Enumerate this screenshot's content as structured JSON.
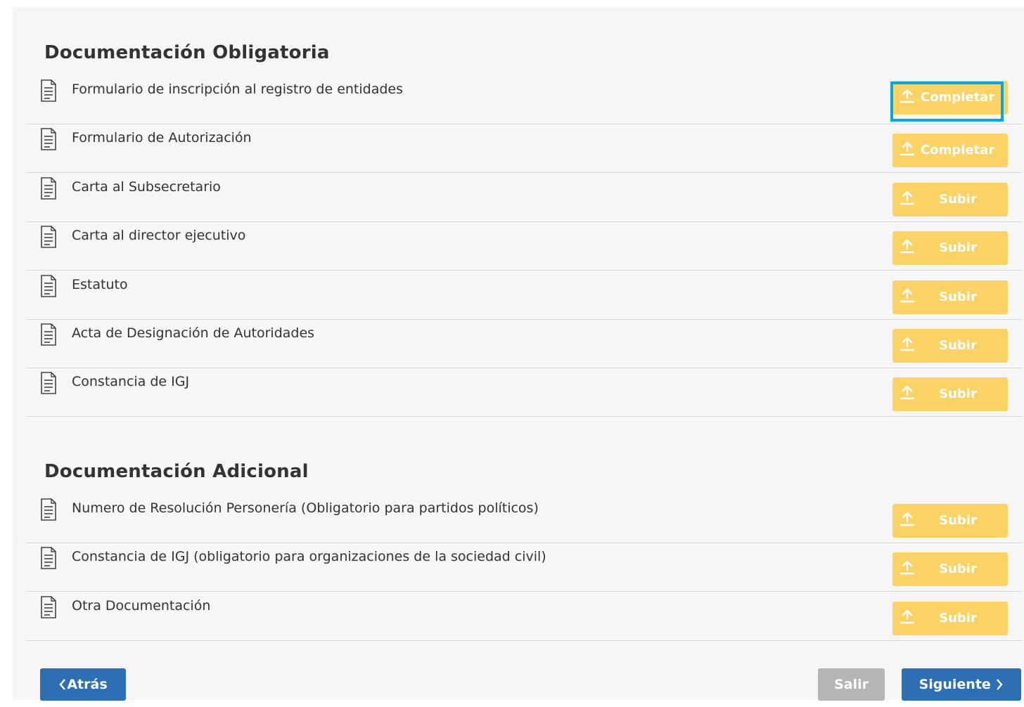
{
  "sections": [
    {
      "title": "Documentación Obligatoria",
      "items": [
        {
          "label": "Formulario de inscripción al registro de entidades",
          "button": "Completar"
        },
        {
          "label": "Formulario de Autorización",
          "button": "Completar"
        },
        {
          "label": "Carta al Subsecretario",
          "button": "Subir"
        },
        {
          "label": "Carta al director ejecutivo",
          "button": "Subir"
        },
        {
          "label": "Estatuto",
          "button": "Subir"
        },
        {
          "label": "Acta de Designación de Autoridades",
          "button": "Subir"
        },
        {
          "label": "Constancia de IGJ",
          "button": "Subir"
        }
      ]
    },
    {
      "title": "Documentación Adicional",
      "items": [
        {
          "label": "Numero de Resolución Personería (Obligatorio para partidos políticos)",
          "button": "Subir"
        },
        {
          "label": "Constancia de IGJ (obligatorio para organizaciones de la sociedad civil)",
          "button": "Subir"
        },
        {
          "label": "Otra Documentación",
          "button": "Subir"
        }
      ]
    }
  ],
  "nav": {
    "back_label": "Atrás",
    "exit_label": "Salir",
    "next_label": "Siguiente"
  },
  "icons": {
    "document": "document-icon",
    "upload": "upload-icon",
    "chevron_left": "chevron-left-icon",
    "chevron_right": "chevron-right-icon"
  },
  "colors": {
    "upload_button": "#fad266",
    "primary_button": "#2e6fb3",
    "exit_button": "#b5b5b5",
    "highlight": "#0aa6df"
  }
}
